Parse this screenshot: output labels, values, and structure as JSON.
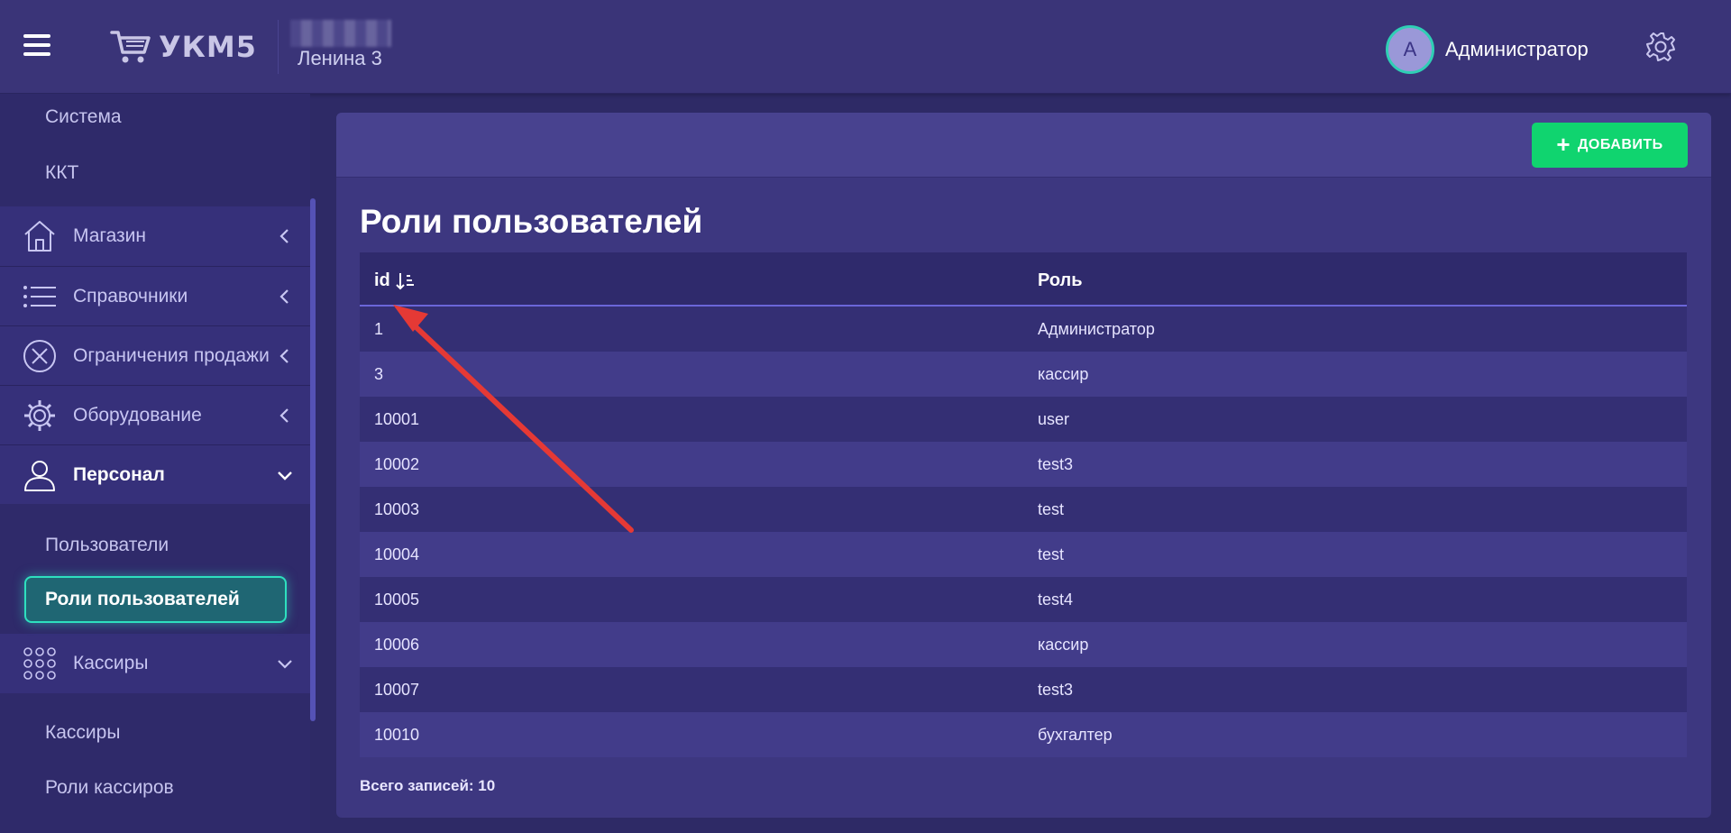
{
  "header": {
    "logo_text": "УКМ5",
    "store_name": "Ленина 3",
    "user_initial": "A",
    "user_name": "Администратор"
  },
  "sidebar": {
    "sub_items_top": [
      "Система",
      "ККТ"
    ],
    "groups": [
      {
        "label": "Магазин",
        "icon": "store-icon",
        "expanded": false
      },
      {
        "label": "Справочники",
        "icon": "list-icon",
        "expanded": false
      },
      {
        "label": "Ограничения продажи",
        "icon": "circle-x-icon",
        "expanded": false
      },
      {
        "label": "Оборудование",
        "icon": "gear-icon",
        "expanded": false
      },
      {
        "label": "Персонал",
        "icon": "person-icon",
        "expanded": true
      },
      {
        "label": "Кассиры",
        "icon": "grid-dots-icon",
        "expanded": true
      }
    ],
    "personal_items": [
      "Пользователи",
      "Роли пользователей"
    ],
    "cashier_items": [
      "Кассиры",
      "Роли кассиров"
    ],
    "active_item": "Роли пользователей"
  },
  "main": {
    "add_button": "ДОБАВИТЬ",
    "title": "Роли пользователей",
    "columns": [
      "id",
      "Роль"
    ],
    "rows": [
      [
        "1",
        "Администратор"
      ],
      [
        "3",
        "кассир"
      ],
      [
        "10001",
        "user"
      ],
      [
        "10002",
        "test3"
      ],
      [
        "10003",
        "test"
      ],
      [
        "10004",
        "test"
      ],
      [
        "10005",
        "test4"
      ],
      [
        "10006",
        "кассир"
      ],
      [
        "10007",
        "test3"
      ],
      [
        "10010",
        "бухгалтер"
      ]
    ],
    "total": "Всего записей: 10"
  },
  "colors": {
    "accent_green": "#10d46f",
    "active_border": "#2ee0bf",
    "annotation_red": "#e53935"
  }
}
